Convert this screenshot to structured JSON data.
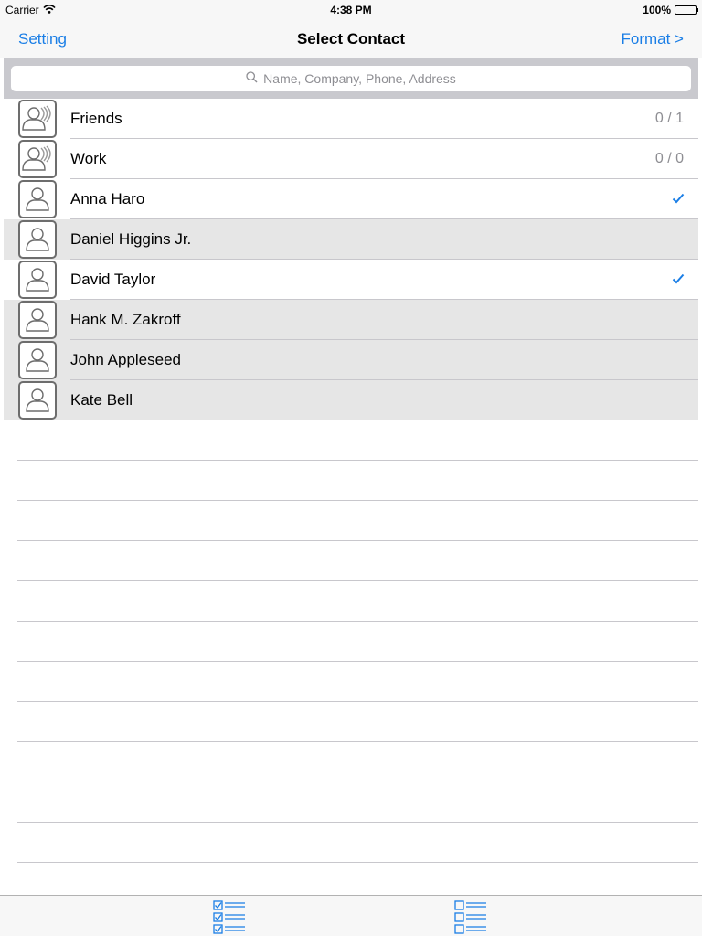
{
  "status": {
    "carrier": "Carrier",
    "time": "4:38 PM",
    "battery": "100%",
    "battery_level": 1.0
  },
  "nav": {
    "left": "Setting",
    "title": "Select Contact",
    "right": "Format >"
  },
  "search": {
    "placeholder": "Name, Company, Phone, Address"
  },
  "rows": [
    {
      "label": "Friends",
      "kind": "group",
      "count": "0 / 1",
      "checked": false,
      "highlight": false
    },
    {
      "label": "Work",
      "kind": "group",
      "count": "0 / 0",
      "checked": false,
      "highlight": false
    },
    {
      "label": "Anna Haro",
      "kind": "person",
      "count": "",
      "checked": true,
      "highlight": false
    },
    {
      "label": "Daniel Higgins Jr.",
      "kind": "person",
      "count": "",
      "checked": false,
      "highlight": true
    },
    {
      "label": "David Taylor",
      "kind": "person",
      "count": "",
      "checked": true,
      "highlight": false
    },
    {
      "label": "Hank M. Zakroff",
      "kind": "person",
      "count": "",
      "checked": false,
      "highlight": true
    },
    {
      "label": "John Appleseed",
      "kind": "person",
      "count": "",
      "checked": false,
      "highlight": true
    },
    {
      "label": "Kate Bell",
      "kind": "person",
      "count": "",
      "checked": false,
      "highlight": true
    }
  ],
  "colors": {
    "accent": "#1a7ee6",
    "row_highlight": "#e6e6e6",
    "icon_gray": "#6d6d6d"
  },
  "icons": {
    "group": "group-contact-icon",
    "person": "person-contact-icon",
    "check": "checkmark-icon",
    "select_all": "select-all-list-icon",
    "deselect_all": "deselect-all-list-icon"
  }
}
